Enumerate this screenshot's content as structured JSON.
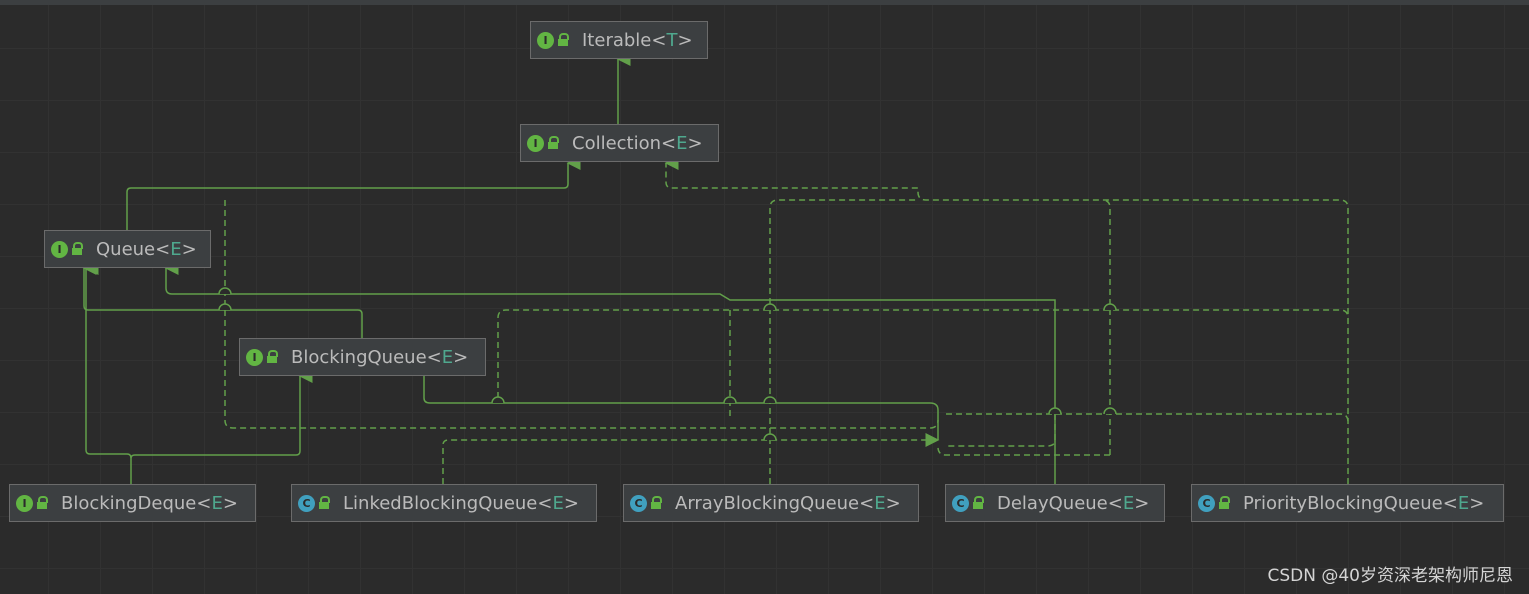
{
  "nodes": {
    "iterable": {
      "kind": "I",
      "name": "Iterable",
      "lt": "<",
      "tparam": "T",
      "gt": ">"
    },
    "collection": {
      "kind": "I",
      "name": "Collection",
      "lt": "<",
      "tparam": "E",
      "gt": ">"
    },
    "queue": {
      "kind": "I",
      "name": "Queue",
      "lt": "<",
      "tparam": "E",
      "gt": ">"
    },
    "blockingqueue": {
      "kind": "I",
      "name": "BlockingQueue",
      "lt": "<",
      "tparam": "E",
      "gt": ">"
    },
    "blockingdeque": {
      "kind": "I",
      "name": "BlockingDeque",
      "lt": "<",
      "tparam": "E",
      "gt": ">"
    },
    "linkedbq": {
      "kind": "C",
      "name": "LinkedBlockingQueue",
      "lt": "<",
      "tparam": "E",
      "gt": ">"
    },
    "arraybq": {
      "kind": "C",
      "name": "ArrayBlockingQueue",
      "lt": "<",
      "tparam": "E",
      "gt": ">"
    },
    "delayqueue": {
      "kind": "C",
      "name": "DelayQueue",
      "lt": "<",
      "tparam": "E",
      "gt": ">"
    },
    "prioritybq": {
      "kind": "C",
      "name": "PriorityBlockingQueue",
      "lt": "<",
      "tparam": "E",
      "gt": ">"
    }
  },
  "watermark": "CSDN @40岁资深老架构师尼恩",
  "colors": {
    "background": "#2b2b2b",
    "edge": "#62a04a",
    "interface_badge": "#62b543",
    "class_badge": "#40a0bf",
    "type_param": "#4fa88e"
  }
}
